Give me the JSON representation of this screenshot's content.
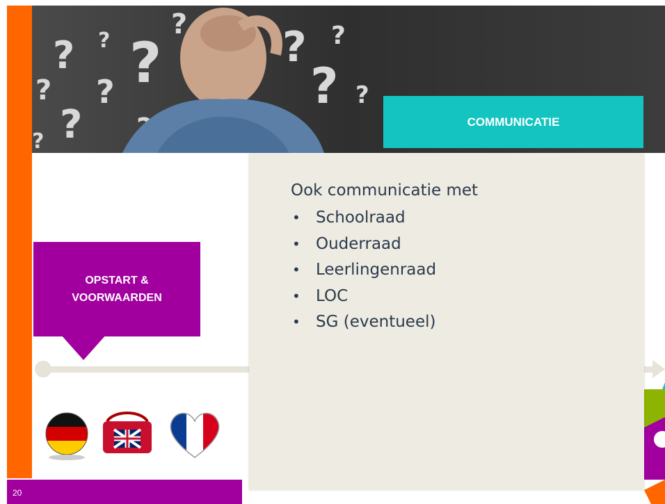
{
  "slide": {
    "section_label": "COMMUNICATIE",
    "milestone_label": "OPSTART & VOORWAARDEN",
    "page_number": "20"
  },
  "content": {
    "intro": "Ook communicatie met",
    "bullets": [
      "Schoolraad",
      "Ouderraad",
      "Leerlingenraad",
      "LOC",
      "SG (eventueel)"
    ]
  },
  "icons": [
    "germany-football-icon",
    "uk-flag-bag-icon",
    "france-heart-icon",
    "question-marks-photo"
  ],
  "colors": {
    "orange": "#ff6600",
    "purple": "#a1009f",
    "teal": "#13c4c0",
    "content_bg": "#eeebe2",
    "text": "#2a3a4c"
  }
}
